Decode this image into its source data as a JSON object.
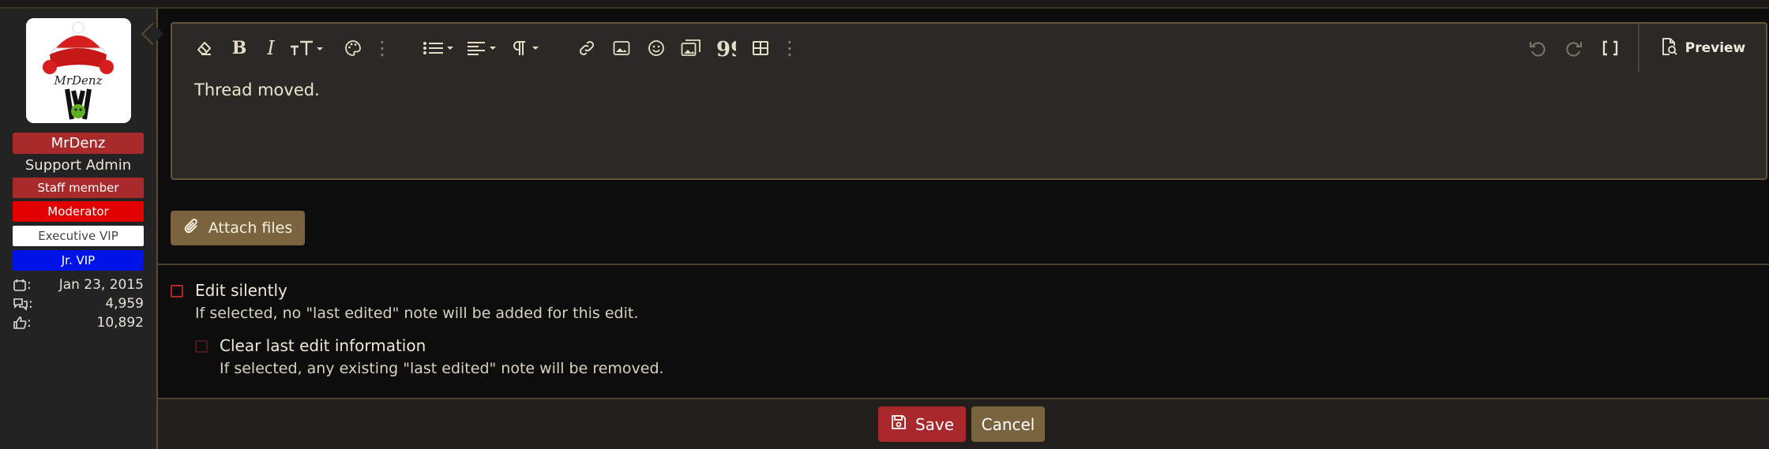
{
  "user": {
    "name": "MrDenz",
    "avatar_text": "MrDenz",
    "title": "Support Admin",
    "banners": [
      "Staff member",
      "Moderator",
      "Executive VIP",
      "Jr. VIP"
    ],
    "stats": [
      {
        "icon": "calendar-icon",
        "value": "Jan 23, 2015"
      },
      {
        "icon": "messages-icon",
        "value": "4,959"
      },
      {
        "icon": "thumbs-up-icon",
        "value": "10,892"
      }
    ],
    "stat_sep": ":"
  },
  "editor": {
    "content": "Thread moved.",
    "preview_label": "Preview"
  },
  "attach_label": "Attach files",
  "options": {
    "edit_silently": {
      "label": "Edit silently",
      "hint": "If selected, no \"last edited\" note will be added for this edit."
    },
    "clear_last_edit": {
      "label": "Clear last edit information",
      "hint": "If selected, any existing \"last edited\" note will be removed."
    }
  },
  "actions": {
    "save": "Save",
    "cancel": "Cancel"
  },
  "colors": {
    "accent": "#7a6440",
    "save": "#a8282c",
    "username_bg": "#a82a2a",
    "moderator": "#e30000",
    "jr_vip": "#0013e6"
  }
}
